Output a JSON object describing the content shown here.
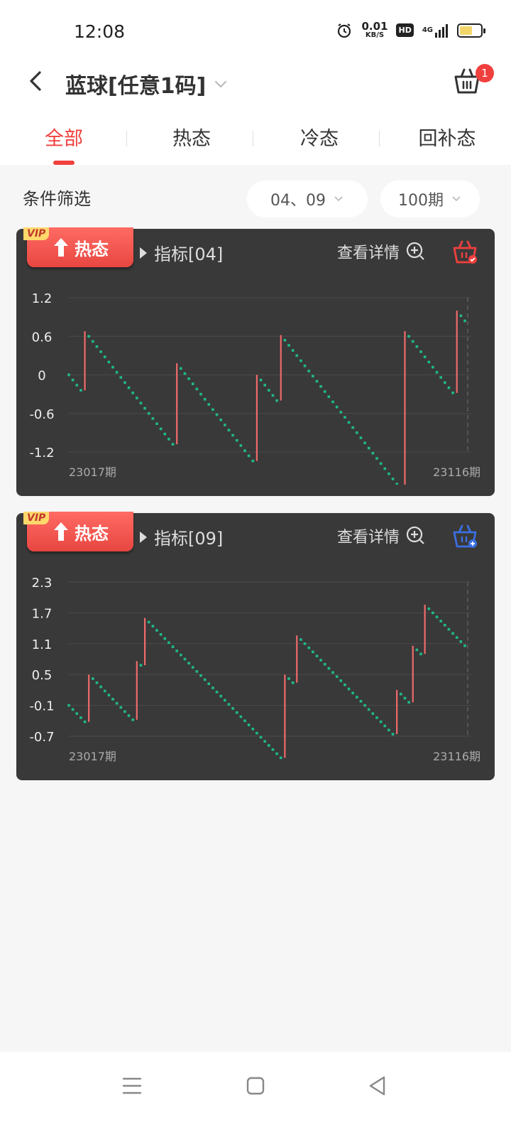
{
  "status_bar": {
    "time": "12:08",
    "net_speed_value": "0.01",
    "net_speed_unit": "KB/S",
    "hd_label": "HD",
    "network_label": "4G",
    "icons": [
      "alarm-icon",
      "hd-icon",
      "signal-icon",
      "battery-icon"
    ]
  },
  "header": {
    "title": "蓝球[任意1码]",
    "cart_count": "1"
  },
  "tabs": [
    {
      "label": "全部",
      "active": true
    },
    {
      "label": "热态",
      "active": false
    },
    {
      "label": "冷态",
      "active": false
    },
    {
      "label": "回补态",
      "active": false
    }
  ],
  "filter": {
    "label": "条件筛选",
    "numbers": "04、09",
    "periods": "100期"
  },
  "colors": {
    "accent": "#f0403e",
    "card_bg": "#393939",
    "up_bar": "#f06a6a",
    "down_step": "#1fb98a",
    "add_blue": "#3b6fe0"
  },
  "cards": [
    {
      "badge_vip": "VIP",
      "badge_label": "热态",
      "indicator": "指标[04]",
      "detail_label": "查看详情",
      "basket_state": "added",
      "chart_data": {
        "type": "line",
        "x_start_label": "23017期",
        "x_end_label": "23116期",
        "ytick_labels": [
          "1.2",
          "0.6",
          "0",
          "-0.6",
          "-1.2"
        ],
        "ylim": [
          -1.2,
          1.2
        ],
        "n": 100,
        "hit_positions": [
          4,
          27,
          47,
          53,
          84,
          97
        ],
        "values": [
          0,
          -0.08,
          -0.16,
          -0.24,
          0.68,
          0.6,
          0.52,
          0.44,
          0.36,
          0.28,
          0.2,
          0.12,
          0.04,
          -0.04,
          -0.12,
          -0.2,
          -0.28,
          -0.36,
          -0.44,
          -0.52,
          -0.6,
          -0.68,
          -0.76,
          -0.84,
          -0.92,
          -1.0,
          -1.08,
          0.18,
          0.1,
          0.02,
          -0.06,
          -0.14,
          -0.22,
          -0.3,
          -0.38,
          -0.46,
          -0.54,
          -0.62,
          -0.7,
          -0.78,
          -0.86,
          -0.94,
          -1.02,
          -1.1,
          -1.18,
          -1.26,
          -1.34,
          0.0,
          -0.08,
          -0.16,
          -0.24,
          -0.32,
          -0.4,
          0.62,
          0.54,
          0.46,
          0.38,
          0.3,
          0.22,
          0.14,
          0.06,
          -0.02,
          -0.1,
          -0.18,
          -0.26,
          -0.34,
          -0.42,
          -0.5,
          -0.58,
          -0.66,
          -0.74,
          -0.82,
          -0.9,
          -0.98,
          -1.06,
          -1.14,
          -1.22,
          -1.3,
          -1.38,
          -1.46,
          -1.54,
          -1.62,
          -1.7,
          -1.78,
          0.68,
          0.6,
          0.52,
          0.44,
          0.36,
          0.28,
          0.2,
          0.12,
          0.04,
          -0.04,
          -0.12,
          -0.2,
          -0.28,
          1.0,
          0.92,
          0.84
        ]
      }
    },
    {
      "badge_vip": "VIP",
      "badge_label": "热态",
      "indicator": "指标[09]",
      "detail_label": "查看详情",
      "basket_state": "add",
      "chart_data": {
        "type": "line",
        "x_start_label": "23017期",
        "x_end_label": "23116期",
        "ytick_labels": [
          "2.3",
          "1.7",
          "1.1",
          "0.5",
          "-0.1",
          "-0.7"
        ],
        "ylim": [
          -0.7,
          2.3
        ],
        "n": 100,
        "hit_positions": [
          5,
          17,
          19,
          54,
          57,
          82,
          86,
          89
        ],
        "values": [
          -0.1,
          -0.18,
          -0.26,
          -0.34,
          -0.42,
          0.5,
          0.42,
          0.34,
          0.26,
          0.18,
          0.1,
          0.02,
          -0.06,
          -0.14,
          -0.22,
          -0.3,
          -0.38,
          0.76,
          0.68,
          1.6,
          1.52,
          1.44,
          1.36,
          1.28,
          1.2,
          1.12,
          1.04,
          0.96,
          0.88,
          0.8,
          0.72,
          0.64,
          0.56,
          0.48,
          0.4,
          0.32,
          0.24,
          0.16,
          0.08,
          0.0,
          -0.08,
          -0.16,
          -0.24,
          -0.32,
          -0.4,
          -0.48,
          -0.56,
          -0.64,
          -0.72,
          -0.8,
          -0.88,
          -0.96,
          -1.04,
          -1.12,
          0.5,
          0.42,
          0.34,
          1.26,
          1.18,
          1.1,
          1.02,
          0.94,
          0.86,
          0.78,
          0.7,
          0.62,
          0.54,
          0.46,
          0.38,
          0.3,
          0.22,
          0.14,
          0.06,
          -0.02,
          -0.1,
          -0.18,
          -0.26,
          -0.34,
          -0.42,
          -0.5,
          -0.58,
          -0.66,
          0.2,
          0.12,
          0.04,
          -0.04,
          1.06,
          0.98,
          0.9,
          1.86,
          1.78,
          1.7,
          1.62,
          1.54,
          1.46,
          1.38,
          1.3,
          1.22,
          1.14,
          1.06
        ]
      }
    }
  ],
  "nav_bar": {
    "icons": [
      "menu-icon",
      "home-icon",
      "back-triangle-icon"
    ]
  }
}
